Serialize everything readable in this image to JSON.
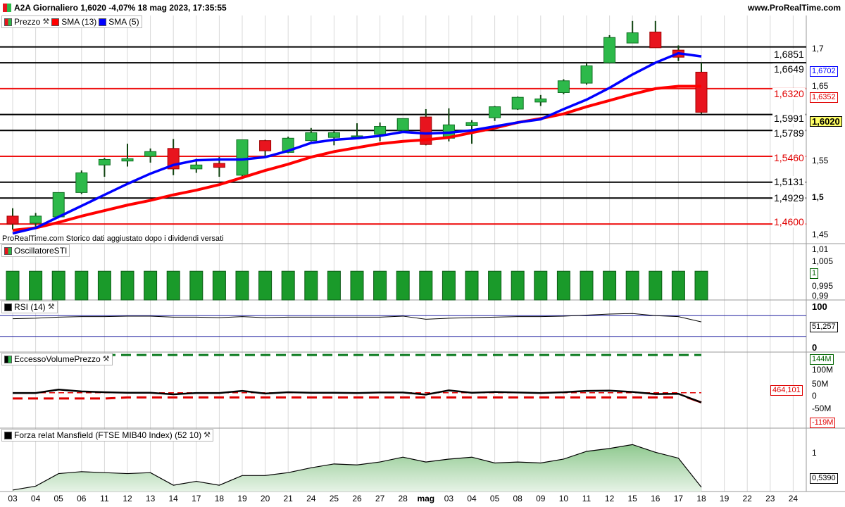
{
  "header": {
    "title": "A2A Giornaliero 1,6020 -4,07% 18 mag 2023, 17:35:55",
    "site": "www.ProRealTime.com"
  },
  "note": "ProRealTime.com Storico dati aggiustato dopo i dividendi versati",
  "colors": {
    "up": "#2db94a",
    "down": "#e8141e",
    "sma13": "#ff0000",
    "sma5": "#0000ff",
    "grid": "#d8d8d8"
  },
  "panes": {
    "price": {
      "legend": [
        {
          "label": "Prezzo",
          "color": "#2db94a"
        },
        {
          "label": "SMA (13)",
          "color": "#ff0000"
        },
        {
          "label": "SMA (5)",
          "color": "#0000ff"
        }
      ],
      "y_ticks": [
        "1,7",
        "1,65",
        "1,55",
        "1,5",
        "1,45"
      ],
      "y_ticks_bold": [
        "1,5"
      ],
      "level_labels": [
        {
          "value": 1.6851,
          "text": "1,6851",
          "color": "#000000"
        },
        {
          "value": 1.6649,
          "text": "1,6649",
          "color": "#000000"
        },
        {
          "value": 1.632,
          "text": "1,6320",
          "color": "#e00000"
        },
        {
          "value": 1.5991,
          "text": "1,5991",
          "color": "#000000"
        },
        {
          "value": 1.5789,
          "text": "1,5789",
          "color": "#000000"
        },
        {
          "value": 1.546,
          "text": "1,5460",
          "color": "#e00000"
        },
        {
          "value": 1.5131,
          "text": "1,5131",
          "color": "#000000"
        },
        {
          "value": 1.4929,
          "text": "1,4929",
          "color": "#000000"
        },
        {
          "value": 1.46,
          "text": "1,4600",
          "color": "#e00000"
        }
      ],
      "badges": [
        {
          "text": "1,6702",
          "color": "#0000ff",
          "value": 1.6702
        },
        {
          "text": "1,6352",
          "color": "#e00000",
          "value": 1.6352
        },
        {
          "text": "1,6020",
          "color": "#000000",
          "value": 1.602,
          "bg": "#ffff66"
        }
      ]
    },
    "sti": {
      "label": "OscillatoreSTI",
      "y_ticks": [
        "1,01",
        "1,005",
        "0,995",
        "0,99"
      ],
      "badge": "1"
    },
    "rsi": {
      "label": "RSI (14)",
      "y_ticks": [
        "100",
        "0"
      ],
      "badge": "51,257"
    },
    "volume": {
      "label": "EccessoVolumePrezzo",
      "y_ticks": [
        "100M",
        "50M",
        "0",
        "-50M"
      ],
      "badges": [
        {
          "text": "144M",
          "color": "#006400"
        },
        {
          "text": "464,101",
          "color": "#e00000"
        },
        {
          "text": "-119M",
          "color": "#e00000"
        }
      ]
    },
    "mansfield": {
      "label": "Forza relat Mansfield (FTSE MIB40 Index) (52 10)",
      "y_ticks": [
        "1"
      ],
      "badge": "0,5390"
    }
  },
  "x_labels": [
    "03",
    "04",
    "05",
    "06",
    "11",
    "12",
    "13",
    "14",
    "17",
    "18",
    "19",
    "20",
    "21",
    "24",
    "25",
    "26",
    "27",
    "28",
    "mag",
    "03",
    "04",
    "05",
    "08",
    "09",
    "10",
    "11",
    "12",
    "15",
    "16",
    "17",
    "18",
    "19",
    "22",
    "23",
    "24"
  ],
  "chart_data": [
    {
      "type": "candlestick",
      "title": "A2A Giornaliero",
      "ylim": [
        1.435,
        1.725
      ],
      "candles": [
        {
          "o": 1.47,
          "h": 1.48,
          "l": 1.453,
          "c": 1.46
        },
        {
          "o": 1.461,
          "h": 1.474,
          "l": 1.455,
          "c": 1.47
        },
        {
          "o": 1.469,
          "h": 1.5,
          "l": 1.468,
          "c": 1.5
        },
        {
          "o": 1.5,
          "h": 1.528,
          "l": 1.498,
          "c": 1.525
        },
        {
          "o": 1.535,
          "h": 1.544,
          "l": 1.52,
          "c": 1.542
        },
        {
          "o": 1.54,
          "h": 1.562,
          "l": 1.533,
          "c": 1.543
        },
        {
          "o": 1.546,
          "h": 1.556,
          "l": 1.538,
          "c": 1.552
        },
        {
          "o": 1.556,
          "h": 1.568,
          "l": 1.522,
          "c": 1.53
        },
        {
          "o": 1.53,
          "h": 1.543,
          "l": 1.525,
          "c": 1.535
        },
        {
          "o": 1.537,
          "h": 1.545,
          "l": 1.52,
          "c": 1.532
        },
        {
          "o": 1.522,
          "h": 1.567,
          "l": 1.52,
          "c": 1.567
        },
        {
          "o": 1.566,
          "h": 1.567,
          "l": 1.545,
          "c": 1.553
        },
        {
          "o": 1.551,
          "h": 1.571,
          "l": 1.55,
          "c": 1.569
        },
        {
          "o": 1.566,
          "h": 1.582,
          "l": 1.565,
          "c": 1.576
        },
        {
          "o": 1.57,
          "h": 1.578,
          "l": 1.56,
          "c": 1.576
        },
        {
          "o": 1.571,
          "h": 1.588,
          "l": 1.57,
          "c": 1.572
        },
        {
          "o": 1.574,
          "h": 1.589,
          "l": 1.565,
          "c": 1.584
        },
        {
          "o": 1.579,
          "h": 1.594,
          "l": 1.578,
          "c": 1.594
        },
        {
          "o": 1.596,
          "h": 1.606,
          "l": 1.56,
          "c": 1.561
        },
        {
          "o": 1.569,
          "h": 1.607,
          "l": 1.565,
          "c": 1.586
        },
        {
          "o": 1.585,
          "h": 1.592,
          "l": 1.562,
          "c": 1.589
        },
        {
          "o": 1.595,
          "h": 1.61,
          "l": 1.591,
          "c": 1.609
        },
        {
          "o": 1.606,
          "h": 1.622,
          "l": 1.605,
          "c": 1.621
        },
        {
          "o": 1.615,
          "h": 1.624,
          "l": 1.61,
          "c": 1.619
        },
        {
          "o": 1.627,
          "h": 1.644,
          "l": 1.625,
          "c": 1.642
        },
        {
          "o": 1.639,
          "h": 1.664,
          "l": 1.637,
          "c": 1.661
        },
        {
          "o": 1.665,
          "h": 1.7,
          "l": 1.664,
          "c": 1.697
        },
        {
          "o": 1.69,
          "h": 1.718,
          "l": 1.69,
          "c": 1.703
        },
        {
          "o": 1.704,
          "h": 1.718,
          "l": 1.684,
          "c": 1.684
        },
        {
          "o": 1.681,
          "h": 1.687,
          "l": 1.667,
          "c": 1.672
        },
        {
          "o": 1.653,
          "h": 1.665,
          "l": 1.6,
          "c": 1.602
        }
      ],
      "sma13": [
        1.452,
        1.455,
        1.462,
        1.47,
        1.477,
        1.484,
        1.49,
        1.497,
        1.503,
        1.51,
        1.519,
        1.528,
        1.536,
        1.545,
        1.552,
        1.557,
        1.562,
        1.565,
        1.567,
        1.57,
        1.576,
        1.582,
        1.589,
        1.594,
        1.6,
        1.609,
        1.617,
        1.625,
        1.632,
        1.635,
        1.635
      ],
      "sma5": [
        1.448,
        1.455,
        1.469,
        1.483,
        1.497,
        1.511,
        1.524,
        1.535,
        1.541,
        1.542,
        1.542,
        1.545,
        1.553,
        1.563,
        1.567,
        1.569,
        1.572,
        1.577,
        1.575,
        1.576,
        1.579,
        1.584,
        1.589,
        1.593,
        1.606,
        1.618,
        1.633,
        1.65,
        1.665,
        1.677,
        1.673
      ]
    },
    {
      "type": "bar",
      "title": "OscillatoreSTI",
      "ylim": [
        0.9875,
        1.012
      ],
      "values": [
        1,
        1,
        1,
        1,
        1,
        1,
        1,
        1,
        1,
        1,
        1,
        1,
        1,
        1,
        1,
        1,
        1,
        1,
        1,
        1,
        1,
        1,
        1,
        1,
        1,
        1,
        1,
        1,
        1,
        1,
        1
      ]
    },
    {
      "type": "line",
      "title": "RSI (14)",
      "ylim": [
        0,
        100
      ],
      "series": [
        {
          "values": [
            64,
            65,
            67,
            68,
            68,
            69,
            69,
            67,
            67,
            66,
            68,
            66,
            67,
            67,
            67,
            67,
            67,
            69,
            63,
            65,
            66,
            67,
            68,
            68,
            69,
            71,
            73,
            74,
            70,
            68,
            58
          ]
        }
      ]
    },
    {
      "type": "line",
      "title": "EccessoVolumePrezzo",
      "ylim": [
        -135,
        155
      ],
      "series": [
        {
          "values": [
            -1,
            -1,
            12,
            5,
            2,
            0,
            0,
            -6,
            -1,
            -1,
            7,
            -3,
            2,
            0,
            0,
            -1,
            1,
            1,
            -7,
            9,
            0,
            3,
            1,
            -1,
            2,
            7,
            8,
            3,
            -5,
            -4,
            -37
          ]
        },
        {
          "values": [
            144,
            144,
            144,
            144,
            144,
            144,
            144,
            144,
            144,
            144,
            144,
            144,
            144,
            144,
            144,
            144,
            144,
            144,
            144,
            144,
            144,
            144,
            144,
            144,
            144,
            144,
            144,
            144,
            144,
            144,
            144
          ]
        },
        {
          "values": [
            -22,
            -22,
            -22,
            -22,
            -22,
            -18,
            -18,
            -18,
            -18,
            -18,
            -18,
            -18,
            -18,
            -18,
            -18,
            -18,
            -18,
            -18,
            -18,
            -18,
            -18,
            -18,
            -18,
            -18,
            -18,
            -18,
            -18,
            -18,
            -18,
            -18,
            null
          ]
        },
        {
          "values": [
            0,
            0,
            0,
            0,
            0,
            0,
            0,
            0,
            0,
            0,
            0,
            0,
            0,
            0,
            0,
            0,
            0,
            0,
            0,
            0,
            0,
            0,
            0,
            0,
            0,
            0,
            0,
            0,
            0,
            0,
            0
          ]
        }
      ]
    },
    {
      "type": "area",
      "title": "Forza relat Mansfield (FTSE MIB40 Index) (52 10)",
      "ylim": [
        0.495,
        1.15
      ],
      "series": [
        {
          "values": [
            0.51,
            0.55,
            0.68,
            0.7,
            0.69,
            0.68,
            0.69,
            0.56,
            0.6,
            0.56,
            0.66,
            0.66,
            0.69,
            0.74,
            0.78,
            0.77,
            0.8,
            0.85,
            0.8,
            0.83,
            0.85,
            0.79,
            0.8,
            0.79,
            0.83,
            0.91,
            0.94,
            0.98,
            0.9,
            0.84,
            0.54
          ]
        }
      ]
    }
  ]
}
